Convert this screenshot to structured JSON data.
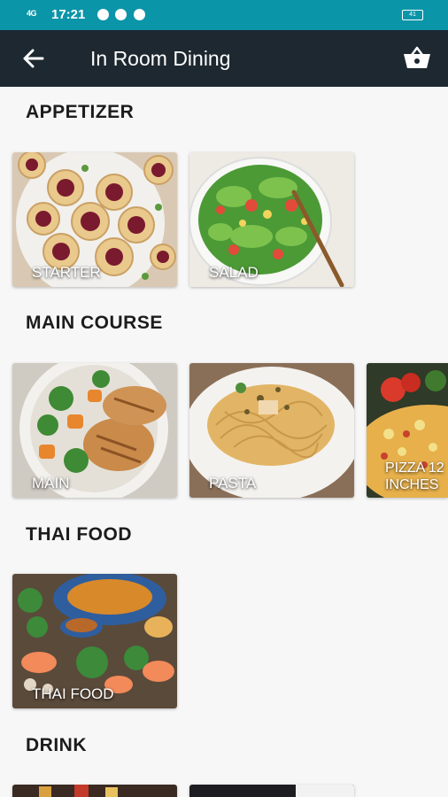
{
  "status_bar": {
    "time": "17:21",
    "signal": "4G",
    "battery": "41"
  },
  "app_bar": {
    "title": "In Room Dining",
    "back_icon": "arrow-left-icon",
    "cart_icon": "basket-icon"
  },
  "sections": [
    {
      "title": "APPETIZER",
      "items": [
        {
          "label": "STARTER"
        },
        {
          "label": "SALAD"
        }
      ]
    },
    {
      "title": "MAIN COURSE",
      "items": [
        {
          "label": "MAIN"
        },
        {
          "label": "PASTA"
        },
        {
          "label": "PIZZA 12 INCHES"
        }
      ]
    },
    {
      "title": "THAI FOOD",
      "items": [
        {
          "label": "THAI FOOD"
        }
      ]
    },
    {
      "title": "DRINK",
      "items": []
    }
  ],
  "colors": {
    "status_bar": "#0b95a8",
    "app_bar": "#1d2830",
    "background": "#f7f7f7"
  }
}
